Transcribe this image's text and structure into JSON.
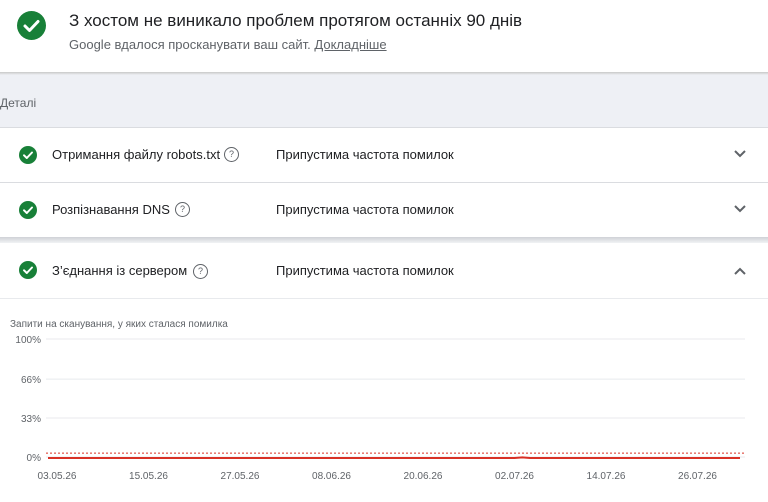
{
  "header": {
    "title": "З хостом не виникало проблем протягом останніх 90 днів",
    "subtitle": "Google вдалося просканувати ваш сайт.",
    "link": "Докладніше",
    "status_icon": "check-circle-icon"
  },
  "details_label": "Деталі",
  "rows": [
    {
      "name": "Отримання файлу robots.txt",
      "status": "Припустима частота помилок",
      "expanded": false
    },
    {
      "name": "Розпізнавання DNS",
      "status": "Припустима частота помилок",
      "expanded": false
    },
    {
      "name": "З’єднання із сервером",
      "status": "Припустима частота помилок",
      "expanded": true
    }
  ],
  "colors": {
    "ok_green": "#188038",
    "line_red": "#d93025",
    "threshold": "#d93025",
    "grid": "#e8eaed"
  },
  "chart_data": {
    "type": "line",
    "title": "Запити на сканування, у яких сталася помилка",
    "y_ticks": [
      "100%",
      "66%",
      "33%",
      "0%"
    ],
    "ylim": [
      0,
      100
    ],
    "x_ticks": [
      "03.05.26",
      "15.05.26",
      "27.05.26",
      "08.06.26",
      "20.06.26",
      "02.07.26",
      "14.07.26",
      "26.07.26"
    ],
    "threshold": 5,
    "series": [
      {
        "values": [
          0,
          0,
          0,
          0,
          0,
          0,
          0,
          0,
          0,
          0,
          0,
          0,
          0,
          0,
          0,
          0,
          0,
          0,
          0,
          0,
          0,
          0,
          0,
          0,
          0,
          0,
          0,
          0,
          0,
          0,
          0,
          0,
          0,
          0,
          0,
          0,
          0,
          0,
          0,
          0,
          0,
          0,
          0,
          0,
          0,
          0,
          0,
          0,
          0,
          0,
          0,
          0,
          0,
          0,
          0,
          0,
          0,
          0,
          0,
          0,
          0,
          0.5,
          0,
          0,
          0,
          0,
          0,
          0,
          0,
          0,
          0,
          0,
          0,
          0,
          0,
          0,
          0,
          0,
          0,
          0,
          0,
          0,
          0,
          0,
          0,
          0,
          0,
          0,
          0,
          0
        ]
      }
    ],
    "grid": true
  }
}
